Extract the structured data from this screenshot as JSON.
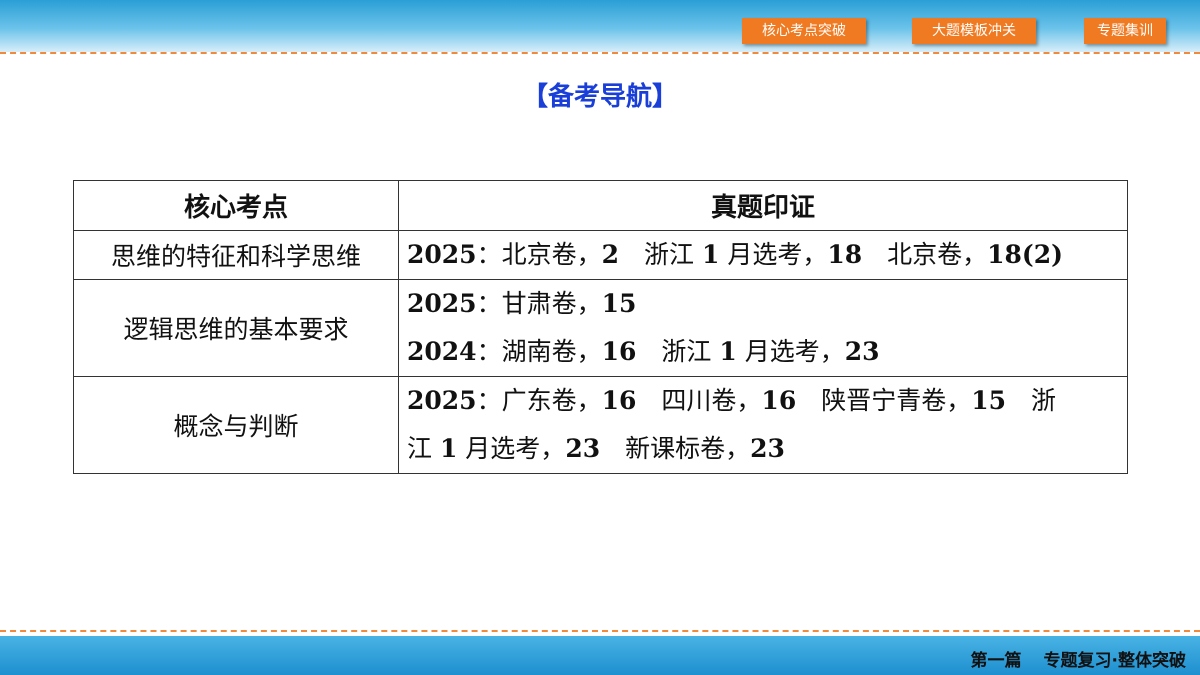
{
  "nav": {
    "tab1": "核心考点突破",
    "tab2": "大题模板冲关",
    "tab3": "专题集训"
  },
  "page_title": "【备考导航】",
  "table": {
    "headers": [
      "核心考点",
      "真题印证"
    ],
    "rows": [
      {
        "topic": "思维的特征和科学思维",
        "lines": [
          [
            {
              "t": "2025",
              "b": true
            },
            {
              "t": "：北京卷，",
              "b": false
            },
            {
              "t": "2",
              "b": true
            },
            {
              "t": "　浙江 ",
              "b": false
            },
            {
              "t": "1",
              "b": true
            },
            {
              "t": " 月选考，",
              "b": false
            },
            {
              "t": "18",
              "b": true
            },
            {
              "t": "　北京卷，",
              "b": false
            },
            {
              "t": "18(2)",
              "b": true
            }
          ]
        ]
      },
      {
        "topic": "逻辑思维的基本要求",
        "lines": [
          [
            {
              "t": "2025",
              "b": true
            },
            {
              "t": "：甘肃卷，",
              "b": false
            },
            {
              "t": "15",
              "b": true
            }
          ],
          [
            {
              "t": "2024",
              "b": true
            },
            {
              "t": "：湖南卷，",
              "b": false
            },
            {
              "t": "16",
              "b": true
            },
            {
              "t": "　浙江 ",
              "b": false
            },
            {
              "t": "1",
              "b": true
            },
            {
              "t": " 月选考，",
              "b": false
            },
            {
              "t": "23",
              "b": true
            }
          ]
        ]
      },
      {
        "topic": "概念与判断",
        "lines": [
          [
            {
              "t": "2025",
              "b": true
            },
            {
              "t": "：广东卷，",
              "b": false
            },
            {
              "t": "16",
              "b": true
            },
            {
              "t": "　四川卷，",
              "b": false
            },
            {
              "t": "16",
              "b": true
            },
            {
              "t": "　陕晋宁青卷，",
              "b": false
            },
            {
              "t": "15",
              "b": true
            },
            {
              "t": "　浙",
              "b": false
            }
          ],
          [
            {
              "t": "江 ",
              "b": false
            },
            {
              "t": "1",
              "b": true
            },
            {
              "t": " 月选考，",
              "b": false
            },
            {
              "t": "23",
              "b": true
            },
            {
              "t": "　新课标卷，",
              "b": false
            },
            {
              "t": "23",
              "b": true
            }
          ]
        ]
      }
    ]
  },
  "footer": {
    "part": "第一篇",
    "section": "专题复习·整体突破"
  },
  "colors": {
    "accent_orange": "#f07a22",
    "title_blue": "#1a3fd8",
    "band_blue": "#2a9fd6"
  }
}
